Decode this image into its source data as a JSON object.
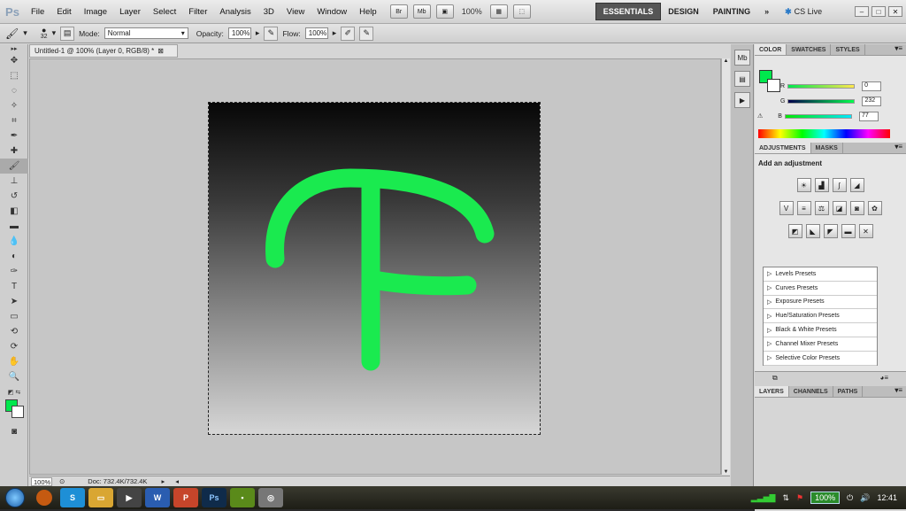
{
  "menubar": {
    "logo": "Ps",
    "menus": [
      "File",
      "Edit",
      "Image",
      "Layer",
      "Select",
      "Filter",
      "Analysis",
      "3D",
      "View",
      "Window",
      "Help"
    ],
    "bridge_label": "Br",
    "minibridge_label": "Mb",
    "zoom": "100%",
    "workspaces": [
      "ESSENTIALS",
      "DESIGN",
      "PAINTING"
    ],
    "more": "»",
    "cslive": "CS Live"
  },
  "options": {
    "brush_size": "32",
    "mode_label": "Mode:",
    "mode_value": "Normal",
    "opacity_label": "Opacity:",
    "opacity_value": "100%",
    "flow_label": "Flow:",
    "flow_value": "100%"
  },
  "document": {
    "tab_title": "Untitled-1 @ 100% (Layer 0, RGB/8) *",
    "stroke_color": "#1aea4f",
    "status_zoom": "100%",
    "status_doc": "Doc: 732.4K/732.4K"
  },
  "color_panel": {
    "tabs": [
      "COLOR",
      "SWATCHES",
      "STYLES"
    ],
    "fg_color": "#00e84d",
    "r_label": "R",
    "r_value": "0",
    "g_label": "G",
    "g_value": "232",
    "b_label": "B",
    "b_value": "77"
  },
  "adjustments_panel": {
    "tabs": [
      "ADJUSTMENTS",
      "MASKS"
    ],
    "title": "Add an adjustment",
    "presets": [
      "Levels Presets",
      "Curves Presets",
      "Exposure Presets",
      "Hue/Saturation Presets",
      "Black & White Presets",
      "Channel Mixer Presets",
      "Selective Color Presets"
    ]
  },
  "layers_panel": {
    "tabs": [
      "LAYERS",
      "CHANNELS",
      "PATHS"
    ]
  },
  "taskbar": {
    "battery": "100%",
    "clock": "12:41"
  }
}
